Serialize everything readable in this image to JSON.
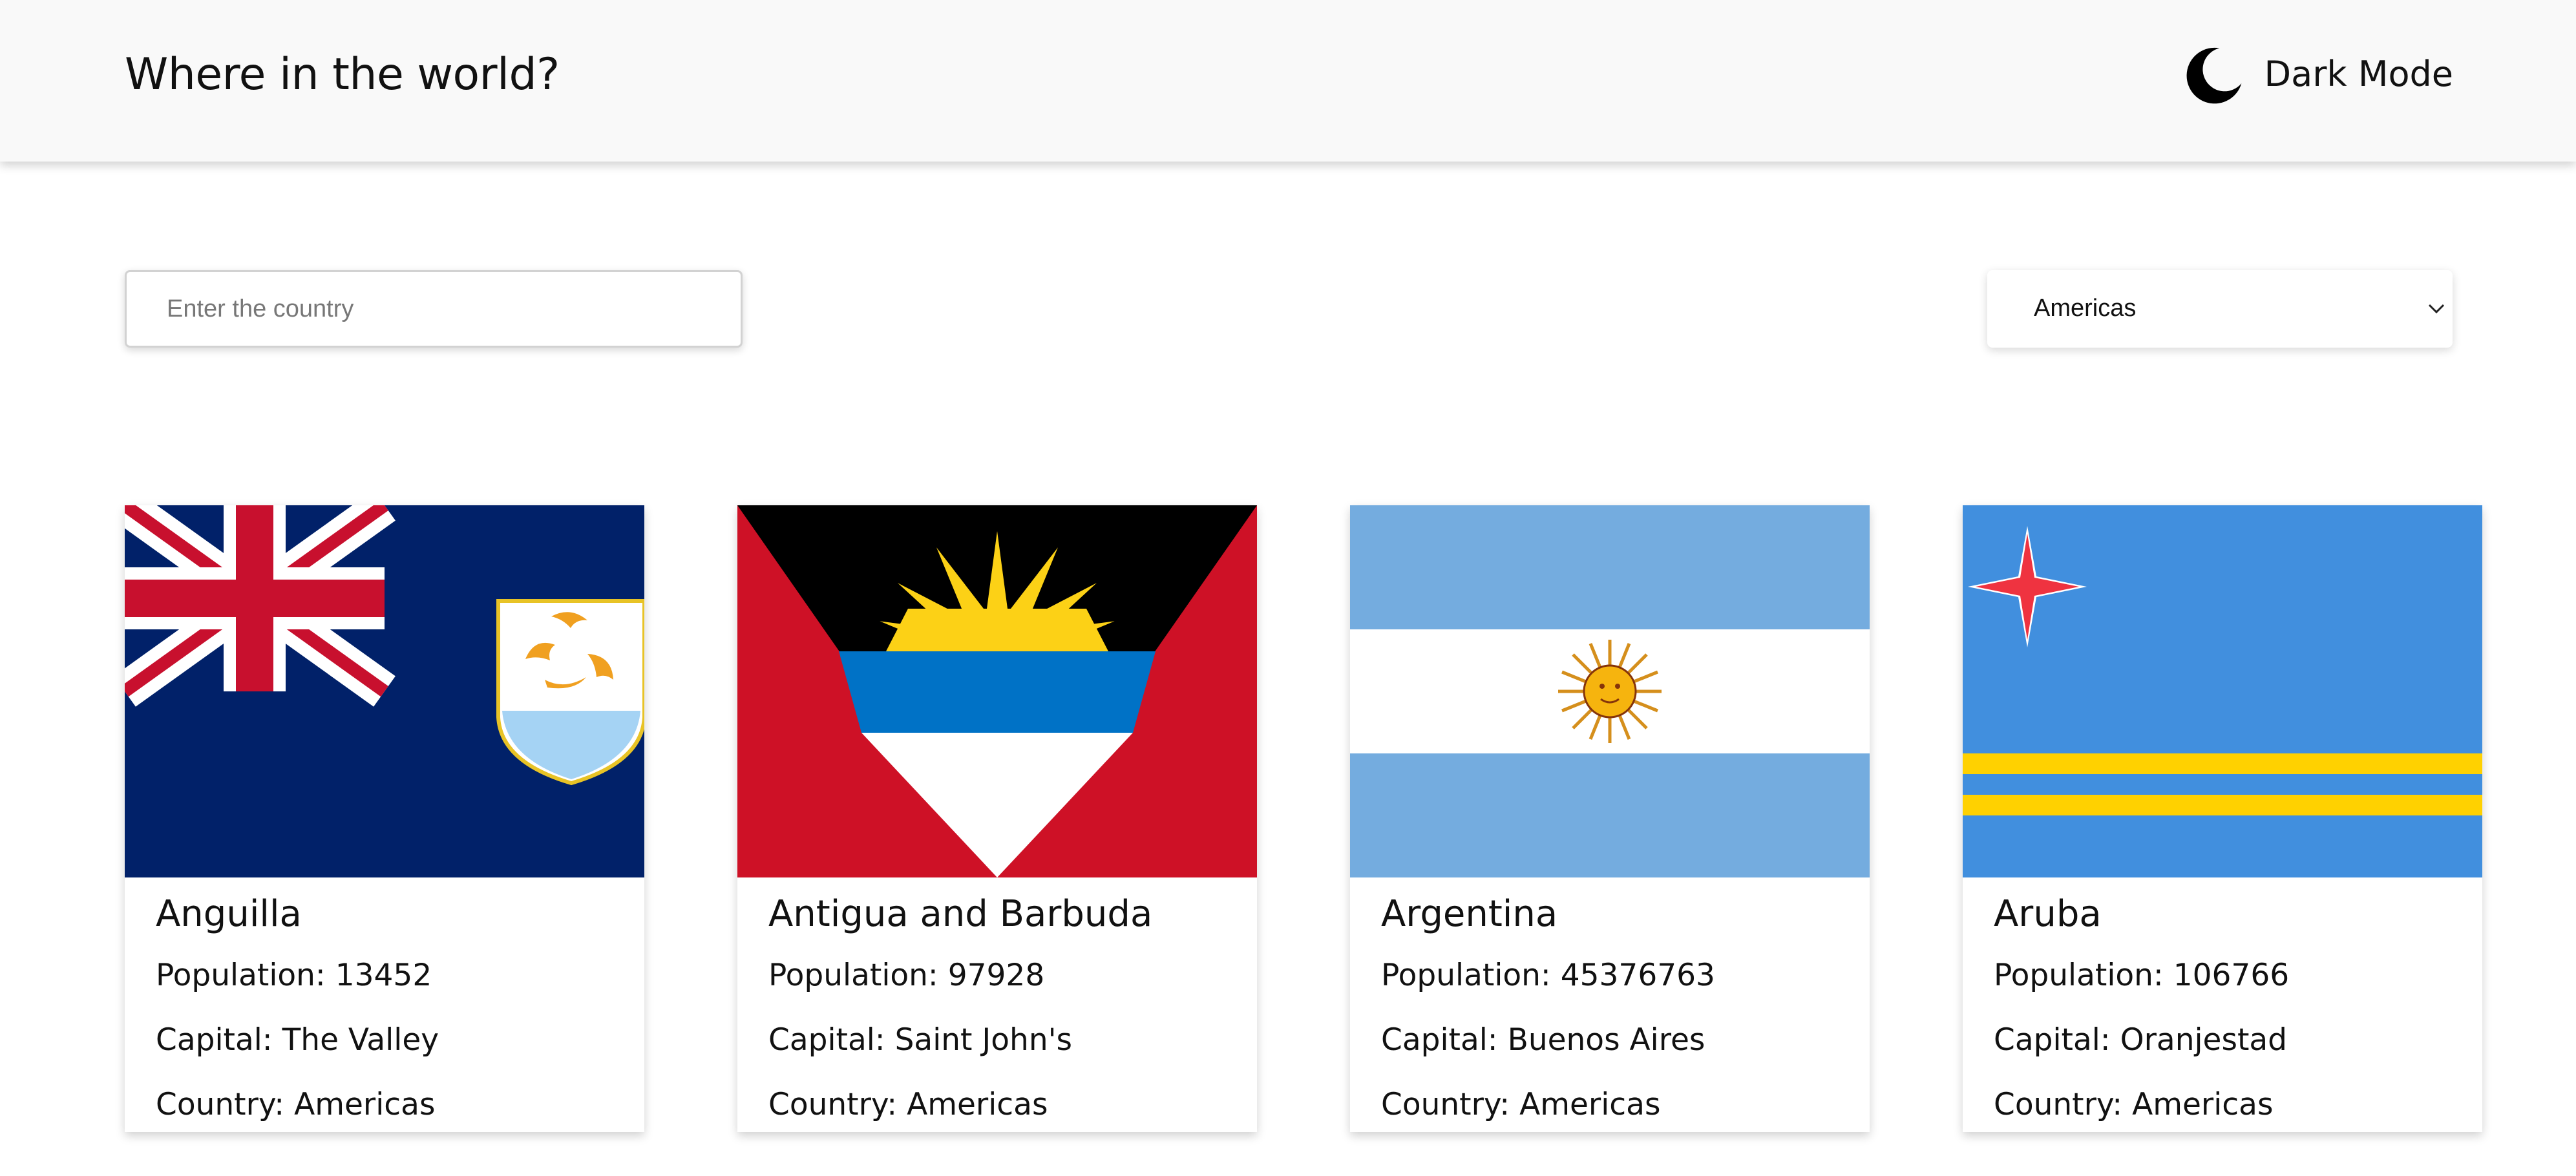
{
  "header": {
    "title": "Where in the world?",
    "theme_icon": "moon-icon",
    "theme_toggle_label": "Dark Mode"
  },
  "search": {
    "placeholder": "Enter the country",
    "value": ""
  },
  "filter": {
    "selected": "Americas",
    "icon": "chevron-down-icon"
  },
  "countries": [
    {
      "name": "Anguilla",
      "population": "Population: 13452",
      "capital": "Capital: The Valley",
      "region": "Country: Americas",
      "flag_icon": "anguilla-flag"
    },
    {
      "name": "Antigua and Barbuda",
      "population": "Population: 97928",
      "capital": "Capital: Saint John's",
      "region": "Country: Americas",
      "flag_icon": "antigua-barbuda-flag"
    },
    {
      "name": "Argentina",
      "population": "Population: 45376763",
      "capital": "Capital: Buenos Aires",
      "region": "Country: Americas",
      "flag_icon": "argentina-flag"
    },
    {
      "name": "Aruba",
      "population": "Population: 106766",
      "capital": "Capital: Oranjestad",
      "region": "Country: Americas",
      "flag_icon": "aruba-flag"
    }
  ],
  "colors": {
    "header_bg": "#f9f9f9",
    "page_bg": "#ffffff",
    "text": "#111111"
  }
}
